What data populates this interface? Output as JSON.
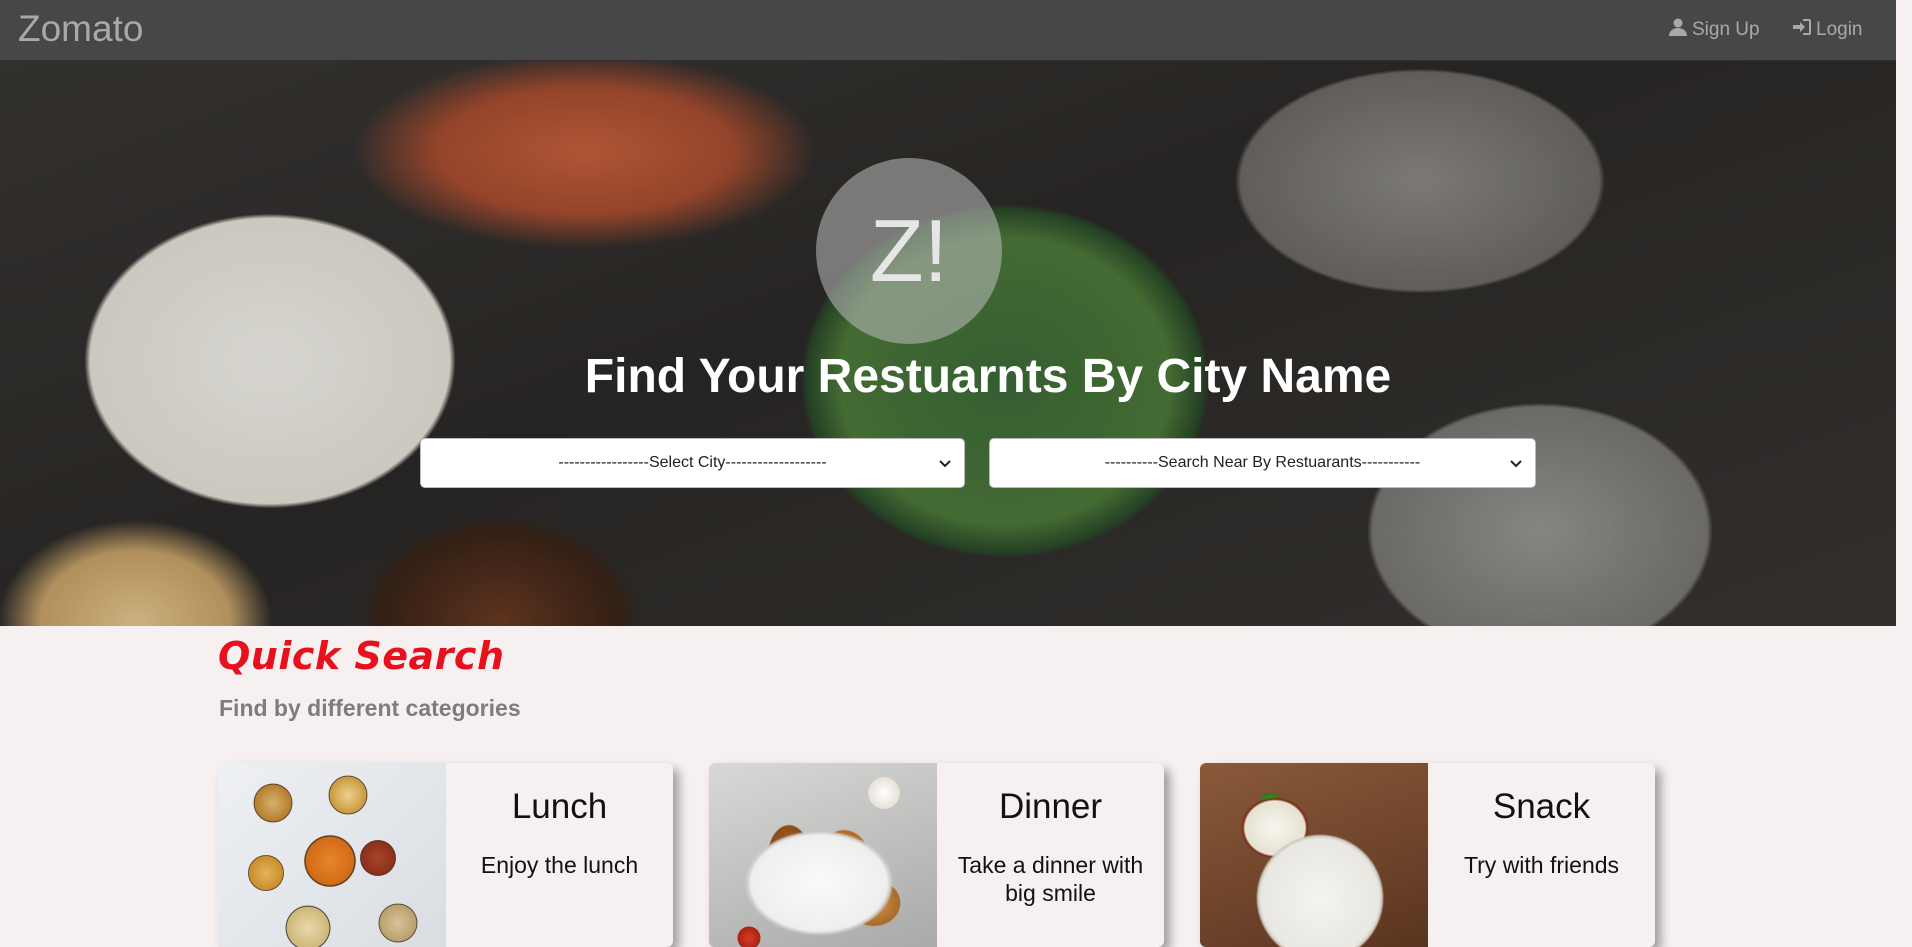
{
  "navbar": {
    "brand": "Zomato",
    "signup_label": "Sign Up",
    "login_label": "Login"
  },
  "hero": {
    "logo_text": "Z!",
    "title": "Find Your Restuarnts By City Name",
    "city_select": "-----------------Select City-------------------",
    "restaurant_select": "----------Search Near By Restuarants-----------"
  },
  "quick_search": {
    "title": "Quick Search",
    "subtitle": "Find by different categories",
    "cards": [
      {
        "title": "Lunch",
        "description": "Enjoy the lunch"
      },
      {
        "title": "Dinner",
        "description": "Take a dinner with big smile"
      },
      {
        "title": "Snack",
        "description": "Try with friends"
      }
    ]
  },
  "icons": {
    "signup": "user-icon",
    "login": "login-icon",
    "dropdown": "chevron-down-icon"
  },
  "colors": {
    "navbar": "#474747",
    "quick_search_title": "#e8101c",
    "subtitle": "#7d7d7d",
    "page_background": "#f6f0f0"
  }
}
